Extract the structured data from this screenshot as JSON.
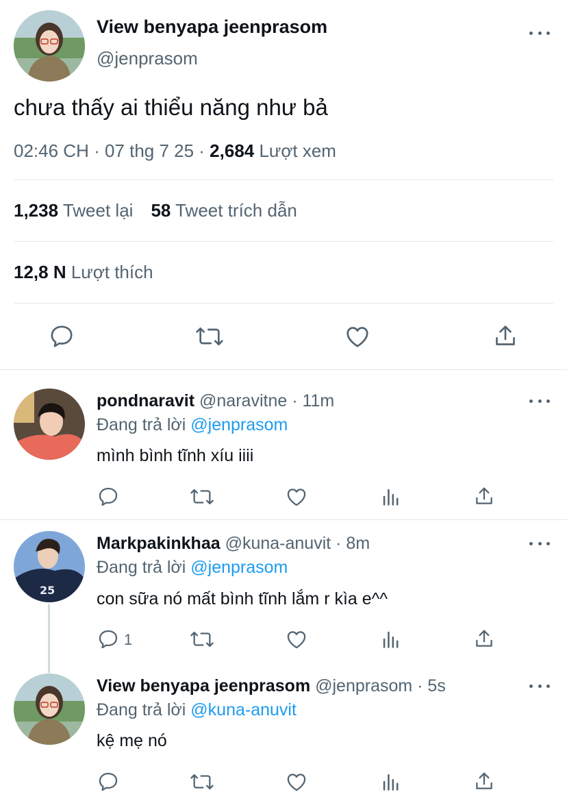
{
  "main_tweet": {
    "display_name": "View benyapa jeenprasom",
    "handle": "@jenprasom",
    "text": "chưa thấy ai thiểu năng như bả",
    "time": "02:46 CH · 07 thg 7 25 · ",
    "views_count": "2,684",
    "views_label": " Lượt xem",
    "retweets_count": "1,238",
    "retweets_label": " Tweet lại",
    "quotes_count": "58",
    "quotes_label": " Tweet trích dẫn",
    "likes_count": "12,8 N",
    "likes_label": "  Lượt thích"
  },
  "replies": [
    {
      "display_name": "pondnaravit",
      "handle_time": " @naravitne · 11m",
      "replying_prefix": "Đang trả lời ",
      "replying_to": "@jenprasom",
      "text": "mình bình tĩnh xíu iiii",
      "reply_count": ""
    },
    {
      "display_name": "Markpakinkhaa",
      "handle_time": " @kuna-anuvit · 8m",
      "replying_prefix": "Đang trả lời ",
      "replying_to": "@jenprasom",
      "text": "con sữa nó mất bình tĩnh lắm r kìa e^^",
      "reply_count": "1"
    },
    {
      "display_name": "View benyapa jeenprasom",
      "handle_time": " @jenprasom · 5s",
      "replying_prefix": "Đang trả lời ",
      "replying_to": "@kuna-anuvit",
      "text": "kệ mẹ nó",
      "reply_count": ""
    }
  ],
  "colors": {
    "accent": "#1d9bf0",
    "secondary_text": "#536471",
    "primary_text": "#0f1419",
    "divider": "#e1e8ed"
  },
  "icons": [
    "more-icon",
    "reply-icon",
    "retweet-icon",
    "like-icon",
    "share-icon",
    "analytics-icon"
  ]
}
